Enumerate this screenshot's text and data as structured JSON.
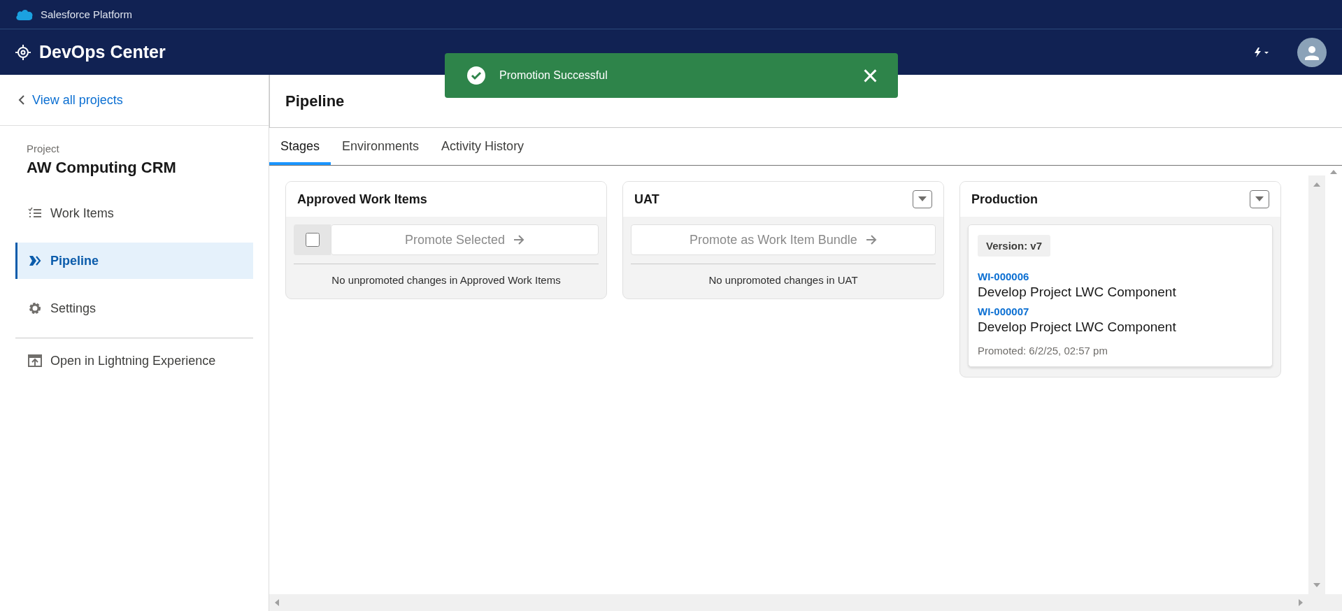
{
  "platform_bar": {
    "title": "Salesforce Platform"
  },
  "header": {
    "app_title": "DevOps Center"
  },
  "toast": {
    "kind": "success",
    "message": "Promotion Successful",
    "close": "×"
  },
  "sidebar": {
    "back_link": "View all projects",
    "project_label": "Project",
    "project_name": "AW Computing CRM",
    "nav": [
      {
        "label": "Work Items",
        "selected": false
      },
      {
        "label": "Pipeline",
        "selected": true
      },
      {
        "label": "Settings",
        "selected": false
      }
    ],
    "footer_link": "Open in Lightning Experience"
  },
  "page": {
    "title": "Pipeline",
    "tabs": [
      {
        "label": "Stages",
        "selected": true
      },
      {
        "label": "Environments",
        "selected": false
      },
      {
        "label": "Activity History",
        "selected": false
      }
    ],
    "stages": [
      {
        "title": "Approved Work Items",
        "has_menu": false,
        "select_all": {
          "checked": false
        },
        "promote_button": {
          "label": "Promote Selected",
          "disabled": true
        },
        "empty_message": "No unpromoted changes in Approved Work Items"
      },
      {
        "title": "UAT",
        "has_menu": true,
        "promote_button": {
          "label": "Promote as Work Item Bundle",
          "disabled": true
        },
        "empty_message": "No unpromoted changes in UAT"
      },
      {
        "title": "Production",
        "has_menu": true,
        "version": {
          "label": "Version: v7",
          "work_items": [
            {
              "id": "WI-000006",
              "name": "Develop Project LWC Component"
            },
            {
              "id": "WI-000007",
              "name": "Develop Project LWC Component"
            }
          ],
          "promoted": "Promoted: 6/2/25, 02:57 pm"
        }
      }
    ]
  }
}
